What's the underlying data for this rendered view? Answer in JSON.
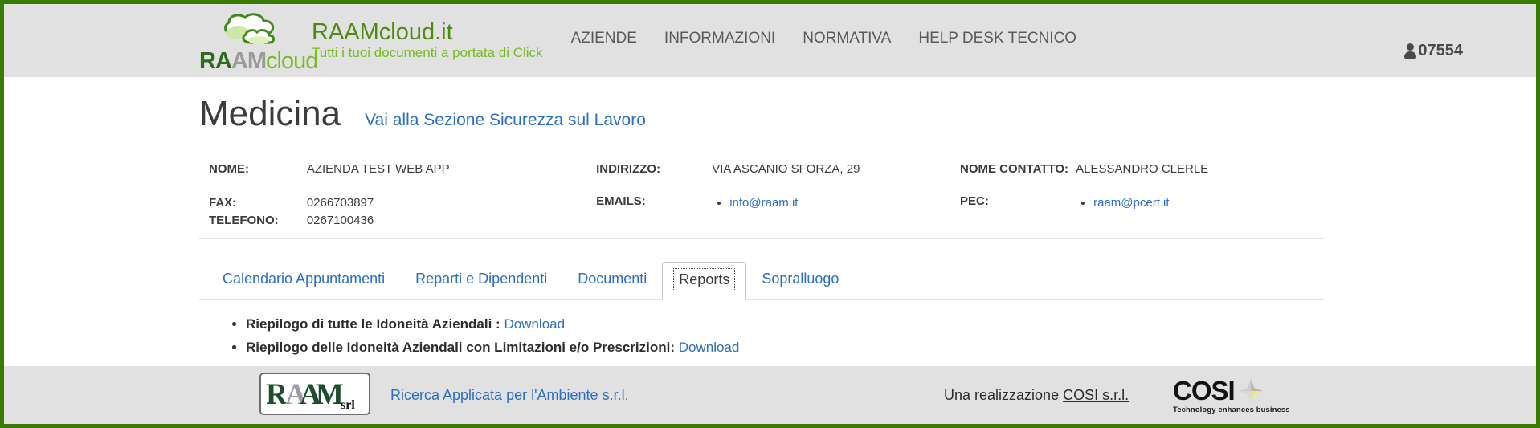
{
  "header": {
    "logo_wordmark": {
      "part1": "RA",
      "part2": "AM",
      "part3": "cloud"
    },
    "brand_title": "RAAMcloud.it",
    "brand_subtitle": "Tutti i tuoi documenti a portata di Click",
    "nav": [
      {
        "label": "AZIENDE",
        "name": "nav-item-aziende"
      },
      {
        "label": "INFORMAZIONI",
        "name": "nav-item-informazioni"
      },
      {
        "label": "NORMATIVA",
        "name": "nav-item-normativa"
      },
      {
        "label": "HELP DESK TECNICO",
        "name": "nav-item-help-desk-tecnico"
      }
    ],
    "user_id": "07554",
    "user_icon": "user-icon"
  },
  "main": {
    "page_title": "Medicina",
    "section_link": "Vai alla Sezione Sicurezza sul Lavoro",
    "info": {
      "nome_label": "NOME:",
      "nome_value": "AZIENDA TEST WEB APP",
      "indirizzo_label": "INDIRIZZO:",
      "indirizzo_value": "VIA ASCANIO SFORZA, 29",
      "contatto_label": "NOME CONTATTO:",
      "contatto_value": "ALESSANDRO CLERLE",
      "fax_label": "FAX:",
      "fax_value": "0266703897",
      "telefono_label": "TELEFONO:",
      "telefono_value": "0267100436",
      "emails_label": "EMAILS:",
      "emails_value": "info@raam.it",
      "pec_label": "PEC:",
      "pec_value": "raam@pcert.it"
    },
    "tabs": [
      {
        "label": "Calendario Appuntamenti",
        "name": "tab-calendario-appuntamenti",
        "active": false
      },
      {
        "label": "Reparti e Dipendenti",
        "name": "tab-reparti-e-dipendenti",
        "active": false
      },
      {
        "label": "Documenti",
        "name": "tab-documenti",
        "active": false
      },
      {
        "label": "Reports",
        "name": "tab-reports",
        "active": true
      },
      {
        "label": "Sopralluogo",
        "name": "tab-sopralluogo",
        "active": false
      }
    ],
    "reports": [
      {
        "text": "Riepilogo di tutte le Idoneità Aziendali :",
        "link": "Download"
      },
      {
        "text": "Riepilogo delle Idoneità Aziendali con Limitazioni e/o Prescrizioni:",
        "link": "Download"
      }
    ]
  },
  "footer": {
    "raam_srl_logo_text": "RAAM srl",
    "left_link": "Ricerca Applicata per l'Ambiente s.r.l.",
    "center_prefix": "Una realizzazione ",
    "center_link": "COSI s.r.l.",
    "cosi_word": "COSI",
    "cosi_tagline": "Technology enhances business"
  },
  "colors": {
    "page_border": "#3a7a00",
    "band": "#e1e1e1",
    "link": "#2b6fc2",
    "brand_green": "#4f8a10",
    "brand_light_green": "#76bc21",
    "cosi_yellow": "#f2e85c"
  }
}
